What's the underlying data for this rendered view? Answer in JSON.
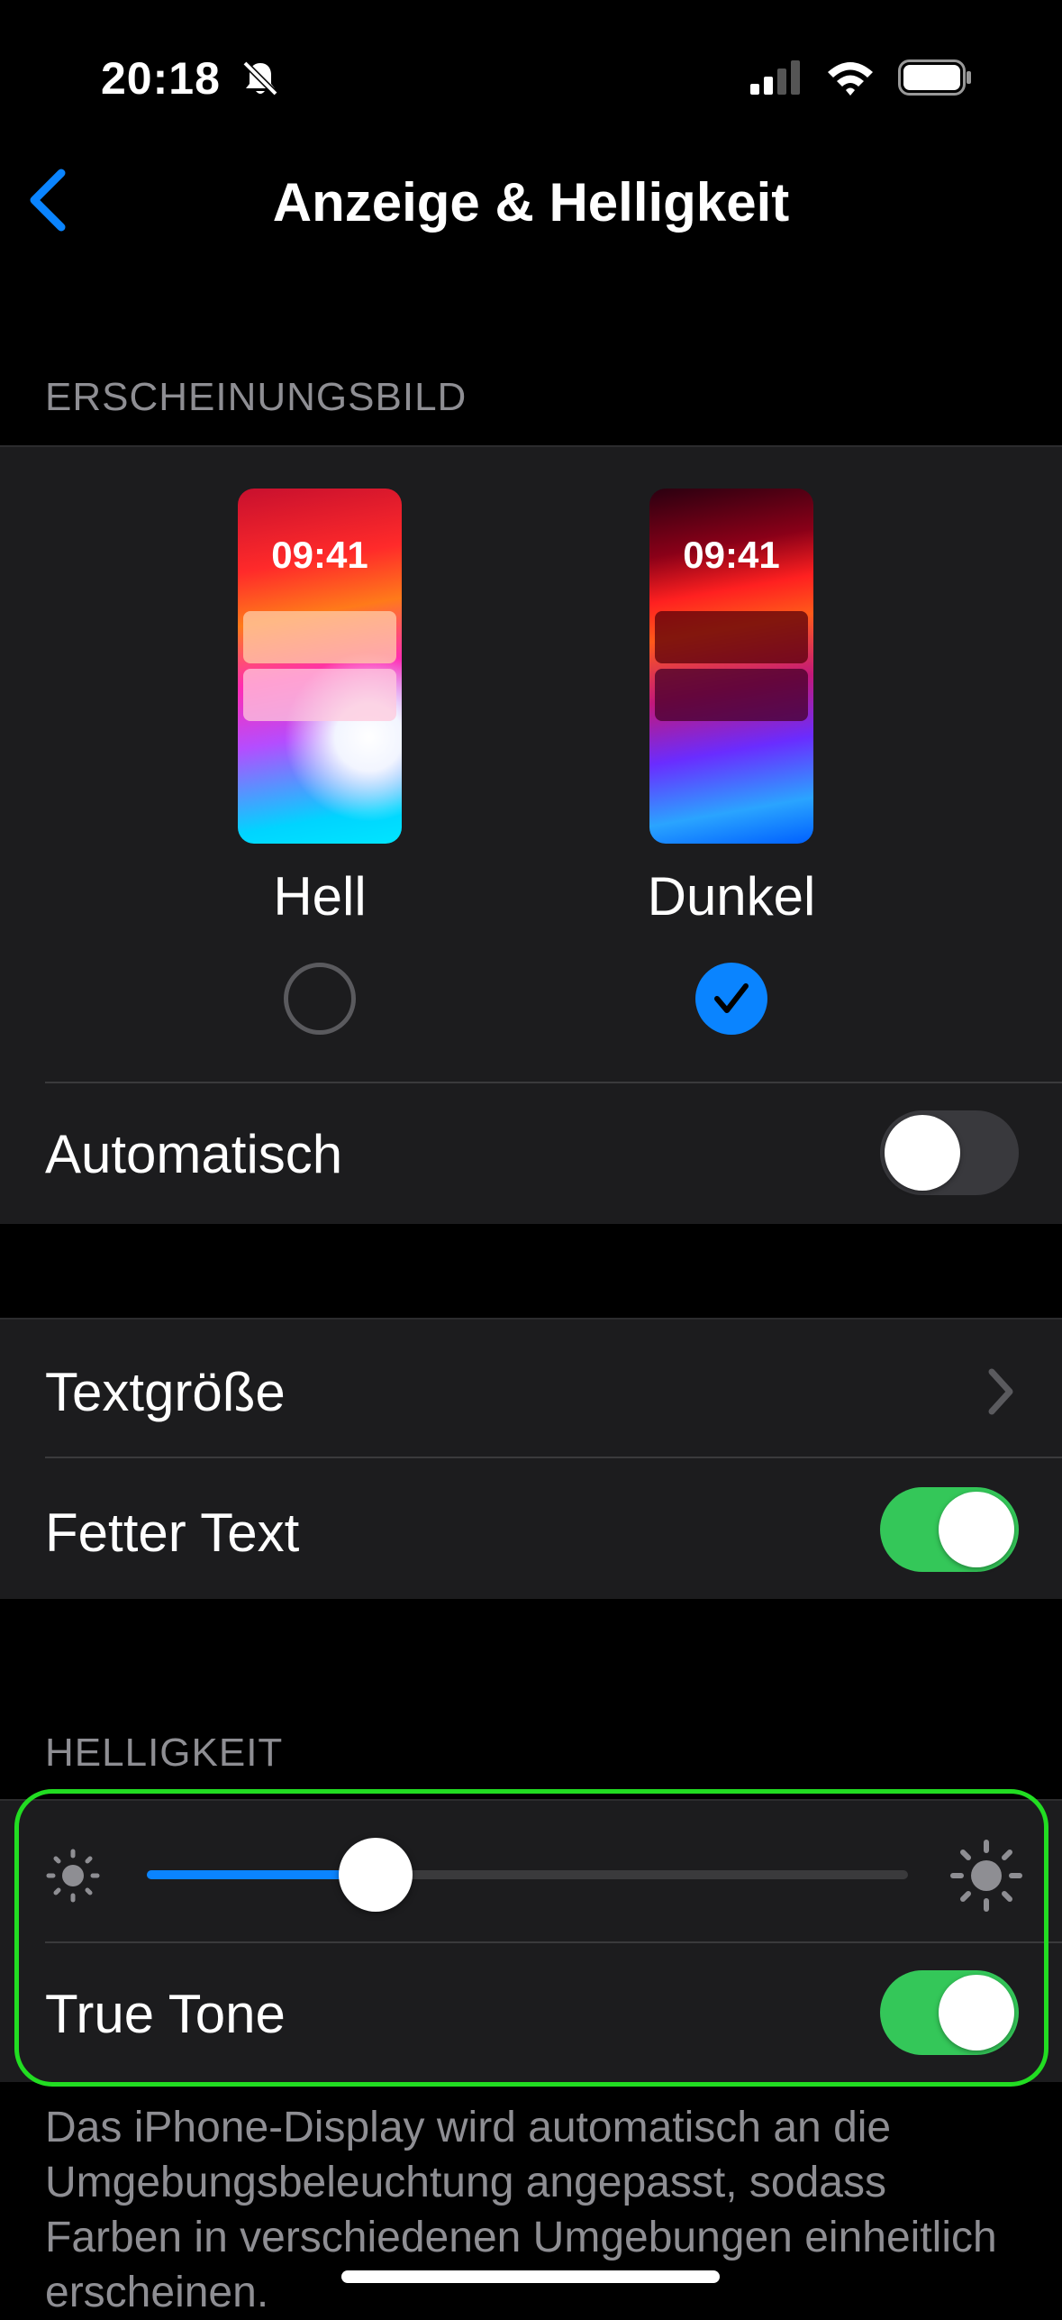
{
  "status_bar": {
    "time": "20:18"
  },
  "nav": {
    "title": "Anzeige & Helligkeit"
  },
  "appearance": {
    "header": "ERSCHEINUNGSBILD",
    "light": {
      "label": "Hell",
      "preview_time": "09:41",
      "selected": false
    },
    "dark": {
      "label": "Dunkel",
      "preview_time": "09:41",
      "selected": true
    },
    "automatic": {
      "label": "Automatisch",
      "on": false
    }
  },
  "text": {
    "text_size_label": "Textgröße",
    "bold_text": {
      "label": "Fetter Text",
      "on": true
    }
  },
  "brightness": {
    "header": "HELLIGKEIT",
    "level": 0.3,
    "true_tone": {
      "label": "True Tone",
      "on": true
    },
    "footer": "Das iPhone-Display wird automatisch an die Umgebungsbeleuchtung angepasst, sodass Farben in verschiedenen Umgebungen einheitlich erscheinen."
  },
  "colors": {
    "accent": "#0a84ff",
    "toggle_on": "#34c759",
    "highlight": "#22dd22"
  }
}
